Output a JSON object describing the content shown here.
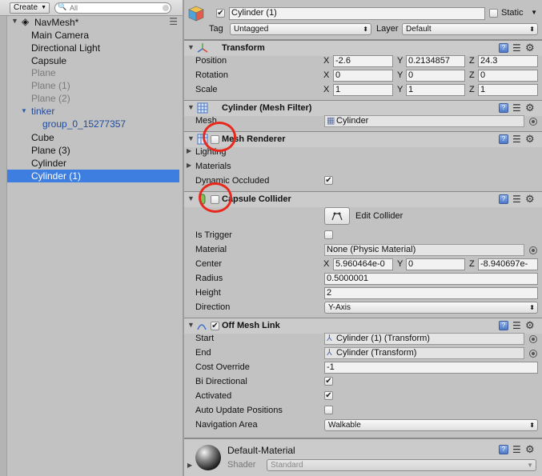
{
  "hierarchy": {
    "create_label": "Create",
    "search_placeholder": "All",
    "scene_name": "NavMesh*",
    "items": [
      {
        "label": "Main Camera"
      },
      {
        "label": "Directional Light"
      },
      {
        "label": "Capsule"
      },
      {
        "label": "Plane"
      },
      {
        "label": "Plane (1)"
      },
      {
        "label": "Plane (2)"
      },
      {
        "label": "tinker"
      },
      {
        "label": "group_0_15277357"
      },
      {
        "label": "Cube"
      },
      {
        "label": "Plane (3)"
      },
      {
        "label": "Cylinder"
      },
      {
        "label": "Cylinder (1)"
      }
    ],
    "selected_item": "Cylinder (1)"
  },
  "inspector": {
    "object_name": "Cylinder (1)",
    "static_label": "Static",
    "tag_label": "Tag",
    "tag_value": "Untagged",
    "layer_label": "Layer",
    "layer_value": "Default",
    "transform": {
      "title": "Transform",
      "axes": [
        "X",
        "Y",
        "Z"
      ],
      "position_label": "Position",
      "position": [
        "-2.6",
        "0.2134857",
        "24.3"
      ],
      "rotation_label": "Rotation",
      "rotation": [
        "0",
        "0",
        "0"
      ],
      "scale_label": "Scale",
      "scale": [
        "1",
        "1",
        "1"
      ]
    },
    "mesh_filter": {
      "title": "Cylinder (Mesh Filter)",
      "mesh_label": "Mesh",
      "mesh_value": "Cylinder"
    },
    "mesh_renderer": {
      "title": "Mesh Renderer",
      "enabled": false,
      "lighting_label": "Lighting",
      "materials_label": "Materials",
      "dynamic_occluded_label": "Dynamic Occluded",
      "dynamic_occluded": true
    },
    "capsule_collider": {
      "title": "Capsule Collider",
      "enabled": false,
      "edit_collider_label": "Edit Collider",
      "is_trigger_label": "Is Trigger",
      "is_trigger": false,
      "material_label": "Material",
      "material_value": "None (Physic Material)",
      "center_label": "Center",
      "center": [
        "5.960464e-0",
        "0",
        "-8.940697e-"
      ],
      "radius_label": "Radius",
      "radius": "0.5000001",
      "height_label": "Height",
      "height": "2",
      "direction_label": "Direction",
      "direction": "Y-Axis"
    },
    "off_mesh_link": {
      "title": "Off Mesh Link",
      "enabled": true,
      "start_label": "Start",
      "start_value": "Cylinder (1) (Transform)",
      "end_label": "End",
      "end_value": "Cylinder (Transform)",
      "cost_override_label": "Cost Override",
      "cost_override": "-1",
      "bi_directional_label": "Bi Directional",
      "bi_directional": true,
      "activated_label": "Activated",
      "activated": true,
      "auto_update_label": "Auto Update Positions",
      "auto_update": false,
      "navigation_area_label": "Navigation Area",
      "navigation_area": "Walkable"
    },
    "material": {
      "name": "Default-Material",
      "shader_label": "Shader",
      "shader_value": "Standard"
    }
  },
  "colors": {
    "selection": "#3d7ee0",
    "annotation_circle": "#e8281c",
    "panel_bg": "#c2c2c2"
  }
}
